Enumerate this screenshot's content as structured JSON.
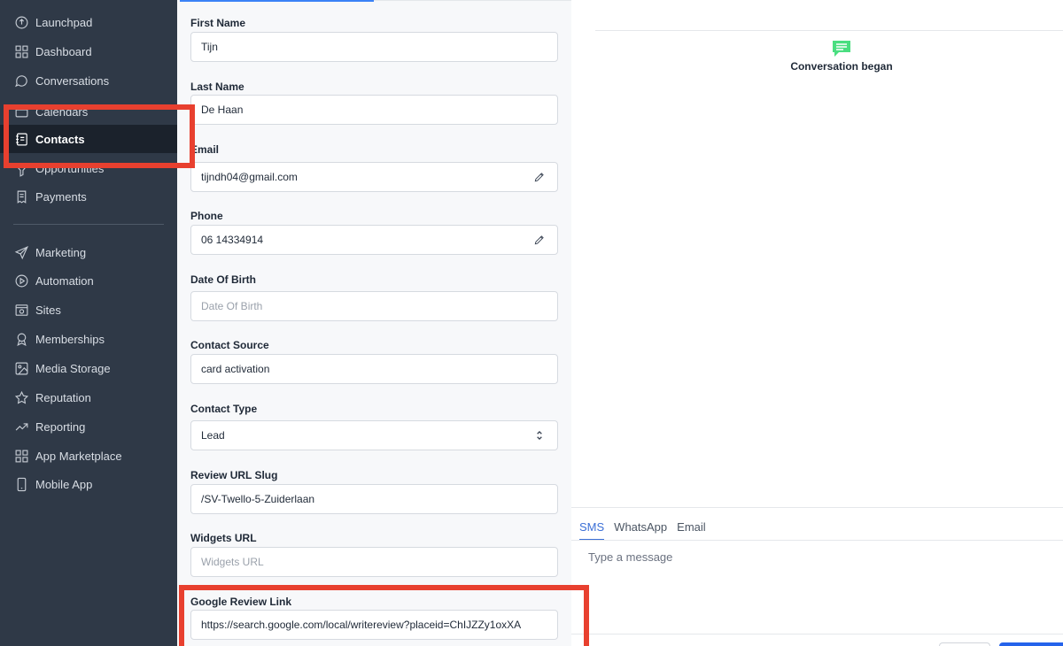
{
  "sidebar": {
    "items": [
      {
        "label": "Launchpad",
        "icon": "rocket-icon"
      },
      {
        "label": "Dashboard",
        "icon": "dashboard-icon"
      },
      {
        "label": "Conversations",
        "icon": "chat-bubble-icon"
      },
      {
        "label": "Calendars",
        "icon": "calendar-icon"
      },
      {
        "label": "Contacts",
        "icon": "contacts-book-icon"
      },
      {
        "label": "Opportunities",
        "icon": "funnel-icon"
      },
      {
        "label": "Payments",
        "icon": "receipt-icon"
      },
      {
        "label": "Marketing",
        "icon": "send-icon"
      },
      {
        "label": "Automation",
        "icon": "automation-icon"
      },
      {
        "label": "Sites",
        "icon": "sites-icon"
      },
      {
        "label": "Memberships",
        "icon": "award-icon"
      },
      {
        "label": "Media Storage",
        "icon": "image-icon"
      },
      {
        "label": "Reputation",
        "icon": "star-icon"
      },
      {
        "label": "Reporting",
        "icon": "trend-icon"
      },
      {
        "label": "App Marketplace",
        "icon": "grid-icon"
      },
      {
        "label": "Mobile App",
        "icon": "mobile-icon"
      }
    ],
    "active": "Contacts"
  },
  "form": {
    "fields": [
      {
        "label": "First Name",
        "value": "Tijn",
        "placeholder": ""
      },
      {
        "label": "Last Name",
        "value": "De Haan",
        "placeholder": ""
      },
      {
        "label": "Email",
        "value": "tijndh04@gmail.com",
        "placeholder": ""
      },
      {
        "label": "Phone",
        "value": "06 14334914",
        "placeholder": ""
      },
      {
        "label": "Date Of Birth",
        "value": "",
        "placeholder": "Date Of Birth"
      },
      {
        "label": "Contact Source",
        "value": "card activation",
        "placeholder": ""
      },
      {
        "label": "Contact Type",
        "value": "Lead",
        "placeholder": ""
      },
      {
        "label": "Review URL Slug",
        "value": "/SV-Twello-5-Zuiderlaan",
        "placeholder": ""
      },
      {
        "label": "Widgets URL",
        "value": "",
        "placeholder": "Widgets URL"
      },
      {
        "label": "Google Review Link",
        "value": "https://search.google.com/local/writereview?placeid=ChIJZZy1oxXA",
        "placeholder": ""
      }
    ]
  },
  "conversation": {
    "event_text": "Conversation began",
    "tabs": [
      "SMS",
      "WhatsApp",
      "Email"
    ],
    "active_tab": "SMS",
    "message_placeholder": "Type a message"
  },
  "colors": {
    "sidebar_bg": "#2f3947",
    "sidebar_active_bg": "#1b222c",
    "highlight": "#e8402f",
    "accent": "#3b6fd6",
    "chat_icon": "#4ade80"
  }
}
